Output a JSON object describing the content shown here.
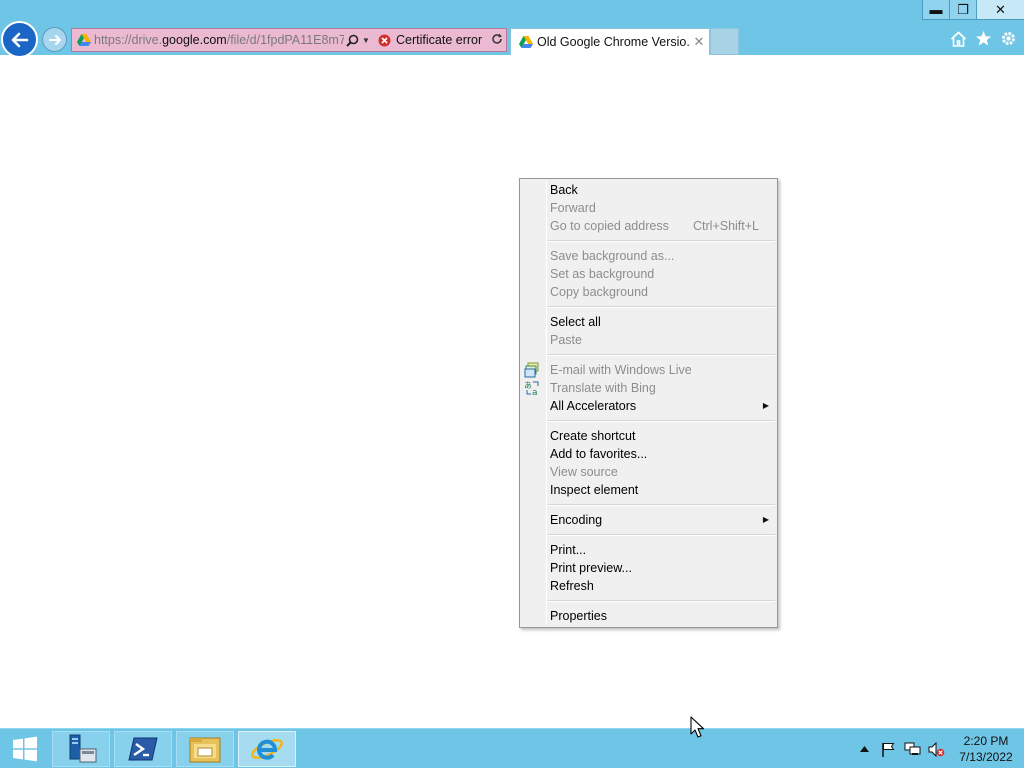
{
  "window": {
    "minimize_symbol": "▬",
    "maximize_symbol": "❐",
    "close_symbol": "✕"
  },
  "address_bar": {
    "url_prefix": "https://drive.",
    "url_domain": "google.com",
    "url_path": "/file/d/1fpdPA11E8m7",
    "certificate_label": "Certificate error"
  },
  "tab": {
    "title": "Old Google Chrome Versio...",
    "close_symbol": "✕"
  },
  "context_menu": {
    "groups": [
      [
        {
          "label": "Back",
          "enabled": true
        },
        {
          "label": "Forward",
          "enabled": false
        },
        {
          "label": "Go to copied address",
          "shortcut": "Ctrl+Shift+L",
          "enabled": false
        }
      ],
      [
        {
          "label": "Save background as...",
          "enabled": false
        },
        {
          "label": "Set as background",
          "enabled": false
        },
        {
          "label": "Copy background",
          "enabled": false
        }
      ],
      [
        {
          "label": "Select all",
          "enabled": true
        },
        {
          "label": "Paste",
          "enabled": false
        }
      ],
      [
        {
          "label": "E-mail with Windows Live",
          "enabled": false,
          "icon": "windows-live-mail-icon"
        },
        {
          "label": "Translate with Bing",
          "enabled": false,
          "icon": "bing-translate-icon"
        },
        {
          "label": "All Accelerators",
          "enabled": true,
          "submenu": true
        }
      ],
      [
        {
          "label": "Create shortcut",
          "enabled": true
        },
        {
          "label": "Add to favorites...",
          "enabled": true
        },
        {
          "label": "View source",
          "enabled": false
        },
        {
          "label": "Inspect element",
          "enabled": true
        }
      ],
      [
        {
          "label": "Encoding",
          "enabled": true,
          "submenu": true
        }
      ],
      [
        {
          "label": "Print...",
          "enabled": true
        },
        {
          "label": "Print preview...",
          "enabled": true
        },
        {
          "label": "Refresh",
          "enabled": true
        }
      ],
      [
        {
          "label": "Properties",
          "enabled": true
        }
      ]
    ]
  },
  "taskbar": {
    "clock_time": "2:20 PM",
    "clock_date": "7/13/2022"
  },
  "colors": {
    "chrome_bg": "#6fc5e6",
    "address_bar_cert_error": "#ebb9d2",
    "back_button": "#1a66c6",
    "menu_bg": "#f0f0f0",
    "disabled_text": "#8d8d8d"
  }
}
